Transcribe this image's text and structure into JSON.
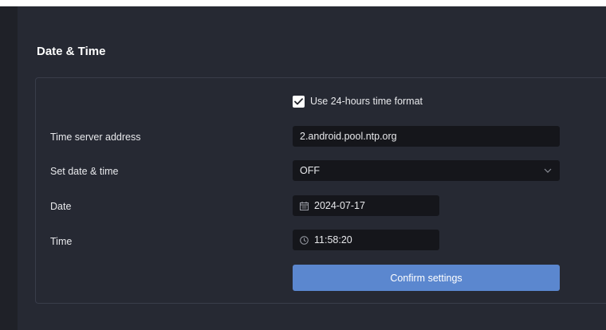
{
  "section": {
    "title": "Date & Time"
  },
  "time_format": {
    "label": "Use 24-hours time format",
    "checked": true
  },
  "time_server": {
    "label": "Time server address",
    "value": "2.android.pool.ntp.org"
  },
  "set_date_time": {
    "label": "Set date & time",
    "value": "OFF"
  },
  "date": {
    "label": "Date",
    "value": "2024-07-17",
    "icon": "calendar-icon"
  },
  "time": {
    "label": "Time",
    "value": "11:58:20",
    "icon": "clock-icon"
  },
  "confirm": {
    "label": "Confirm settings"
  },
  "colors": {
    "accent": "#5b87cf",
    "background": "#1f2128",
    "panel": "#262933",
    "field": "#15161b"
  }
}
